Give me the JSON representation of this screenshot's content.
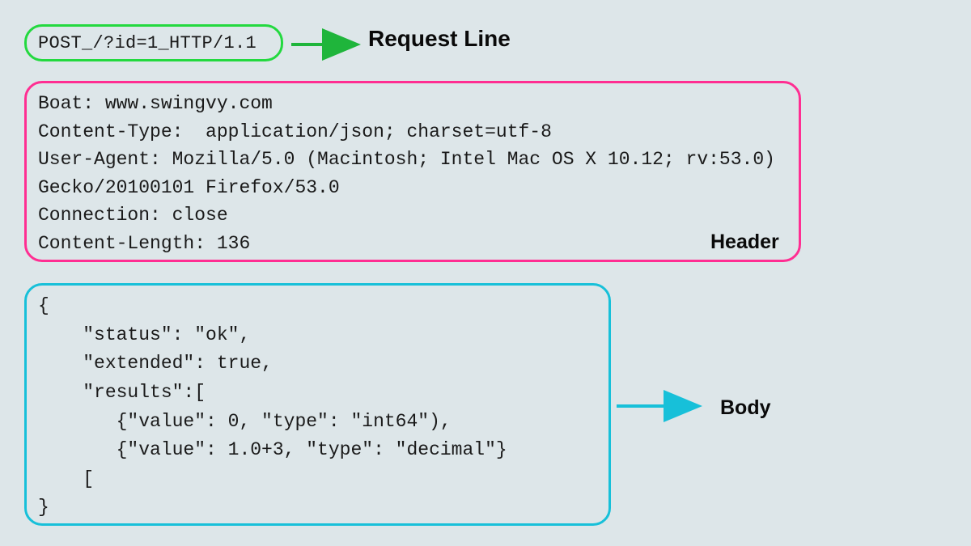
{
  "colors": {
    "bg": "#dde6e9",
    "request_line_border": "#23d93f",
    "header_border": "#ff2e92",
    "body_border": "#17c0d9",
    "arrow_green": "#1fb53b",
    "arrow_cyan": "#17c0d9"
  },
  "labels": {
    "request_line": "Request Line",
    "header": "Header",
    "body": "Body"
  },
  "request_line": {
    "text": "POST_/?id=1_HTTP/1.1"
  },
  "header": {
    "lines": [
      "Boat: www.swingvy.com",
      "Content-Type:  application/json; charset=utf-8",
      "User-Agent: Mozilla/5.0 (Macintosh; Intel Mac OS X 10.12; rv:53.0)",
      "Gecko/20100101 Firefox/53.0",
      "Connection: close",
      "Content-Length: 136"
    ]
  },
  "body": {
    "lines": [
      "{",
      "    \"status\": \"ok\",",
      "    \"extended\": true,",
      "    \"results\":[",
      "       {\"value\": 0, \"type\": \"int64\"),",
      "       {\"value\": 1.0+3, \"type\": \"decimal\"}",
      "    [",
      "}"
    ]
  }
}
